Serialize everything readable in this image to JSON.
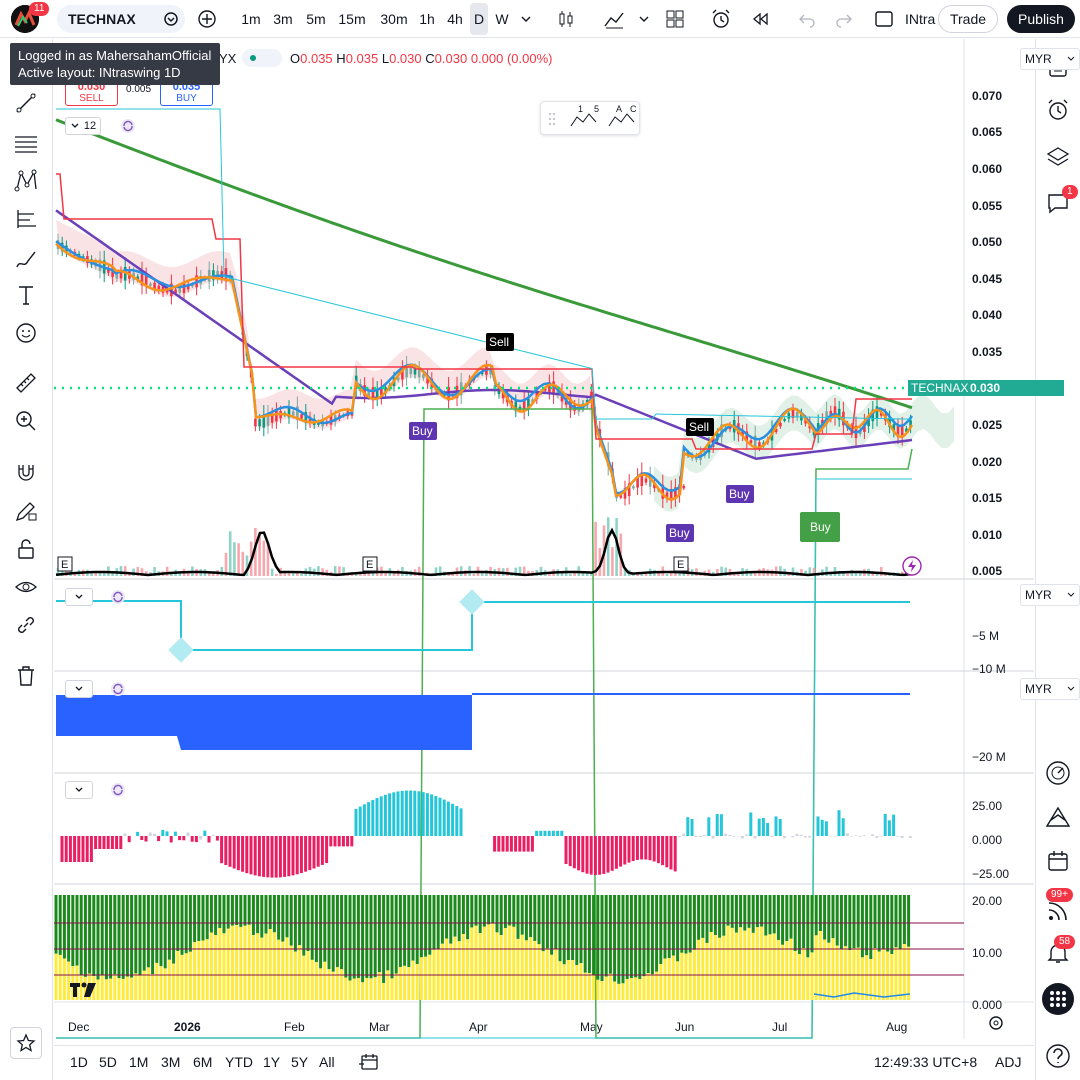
{
  "topbar": {
    "notification_count": "11",
    "symbol": "TECHNAX",
    "timeframes": [
      "1m",
      "3m",
      "5m",
      "15m",
      "30m",
      "1h",
      "4h",
      "D",
      "W"
    ],
    "active_timeframe": "D",
    "layout_name": "INtra",
    "trade_label": "Trade",
    "publish_label": "Publish"
  },
  "tooltip": {
    "line1": "Logged in as MahersahamOfficial",
    "line2": "Active layout: INtraswing 1D"
  },
  "legend": {
    "symbol_suffix": "YX",
    "open_label": "O",
    "open": "0.035",
    "high_label": "H",
    "high": "0.035",
    "low_label": "L",
    "low": "0.030",
    "close_label": "C",
    "close": "0.030",
    "change": "0.000 (0.00%)"
  },
  "trade_panel": {
    "sell_price": "0.030",
    "sell_label": "SELL",
    "spread": "0.005",
    "buy_price": "0.035",
    "buy_label": "BUY"
  },
  "indicator_count": "12",
  "currency": "MYR",
  "price_axis": [
    "0.070",
    "0.065",
    "0.060",
    "0.055",
    "0.050",
    "0.045",
    "0.040",
    "0.035",
    "0.030",
    "0.025",
    "0.020",
    "0.015",
    "0.010",
    "0.005"
  ],
  "current_price_tag": {
    "symbol": "TECHNAX",
    "price": "0.030"
  },
  "signals": [
    "Sell",
    "Sell",
    "Buy",
    "Buy",
    "Buy",
    "Buy"
  ],
  "earnings_marker": "E",
  "pane2_axis": [
    "−5 M",
    "−10 M"
  ],
  "pane3_axis": [
    "−20 M"
  ],
  "pane4_axis": [
    "25.00",
    "0.000",
    "−25.00"
  ],
  "pane5_axis": [
    "20.00",
    "10.00",
    "0.000"
  ],
  "time_axis": [
    "Dec",
    "2026",
    "Feb",
    "Mar",
    "Apr",
    "May",
    "Jun",
    "Jul",
    "Aug"
  ],
  "bottombar": {
    "ranges": [
      "1D",
      "5D",
      "1M",
      "3M",
      "6M",
      "YTD",
      "1Y",
      "5Y",
      "All"
    ],
    "clock": "12:49:33 UTC+8",
    "adj": "ADJ"
  },
  "right_badges": {
    "chat": "1",
    "signals": "99+",
    "alerts": "58"
  },
  "pattern_labels": {
    "a": "1",
    "b": "5",
    "c": "A",
    "d": "C"
  },
  "colors": {
    "green_ma": "#3a9a3a",
    "purple_ma": "#6a3fb8",
    "blue_ma": "#2b8fe0",
    "orange_ma": "#f7931a",
    "red": "#f23645",
    "cyan": "#26c6da",
    "blue_area": "#2962ff",
    "yellow": "#ffeb3b",
    "dark_green": "#1b8a1b"
  }
}
